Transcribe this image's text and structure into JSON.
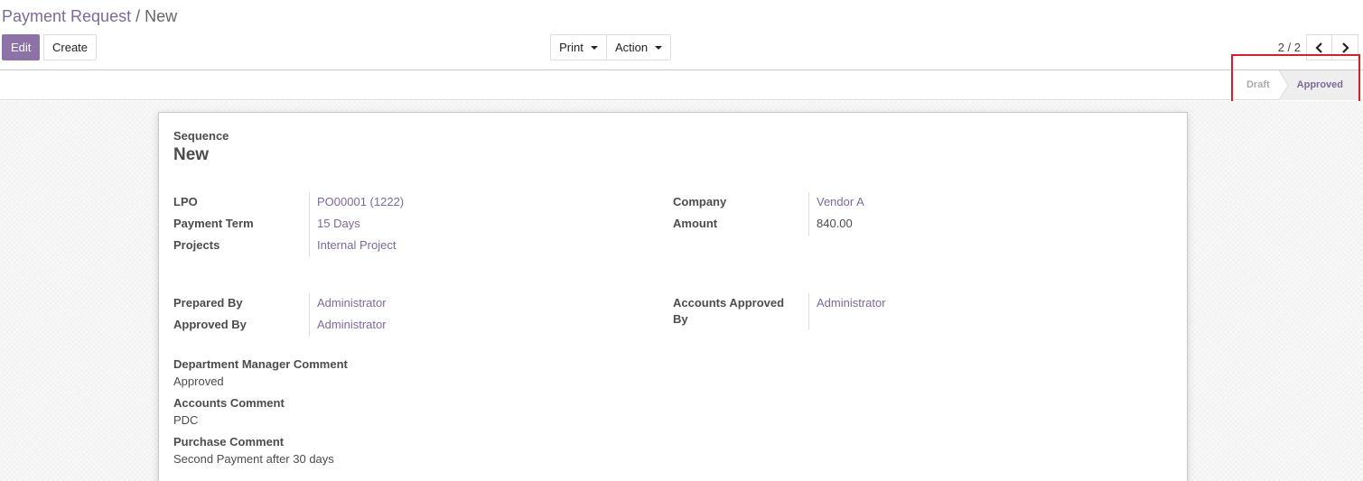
{
  "breadcrumb": {
    "parent": "Payment Request",
    "separator": "/",
    "current": "New"
  },
  "buttons": {
    "edit": "Edit",
    "create": "Create",
    "print": "Print",
    "action": "Action"
  },
  "pager": {
    "value": "2 / 2"
  },
  "statusbar": {
    "stages": [
      "Draft",
      "Approved"
    ],
    "active": "Approved"
  },
  "form": {
    "sequence_label": "Sequence",
    "sequence_value": "New",
    "lpo_label": "LPO",
    "lpo_value": "PO00001 (1222)",
    "payment_term_label": "Payment Term",
    "payment_term_value": "15 Days",
    "projects_label": "Projects",
    "projects_value": "Internal Project",
    "company_label": "Company",
    "company_value": "Vendor A",
    "amount_label": "Amount",
    "amount_value": "840.00",
    "prepared_by_label": "Prepared By",
    "prepared_by_value": "Administrator",
    "approved_by_label": "Approved By",
    "approved_by_value": "Administrator",
    "accounts_approved_by_label_1": "Accounts Approved",
    "accounts_approved_by_label_2": "By",
    "accounts_approved_by_value": "Administrator",
    "dept_manager_comment_label": "Department Manager Comment",
    "dept_manager_comment_value": "Approved",
    "accounts_comment_label": "Accounts Comment",
    "accounts_comment_value": "PDC",
    "purchase_comment_label": "Purchase Comment",
    "purchase_comment_value": "Second Payment after 30 days"
  },
  "colors": {
    "brand": "#8d72a8",
    "link": "#7c6a9a",
    "highlight": "#d0212c"
  }
}
